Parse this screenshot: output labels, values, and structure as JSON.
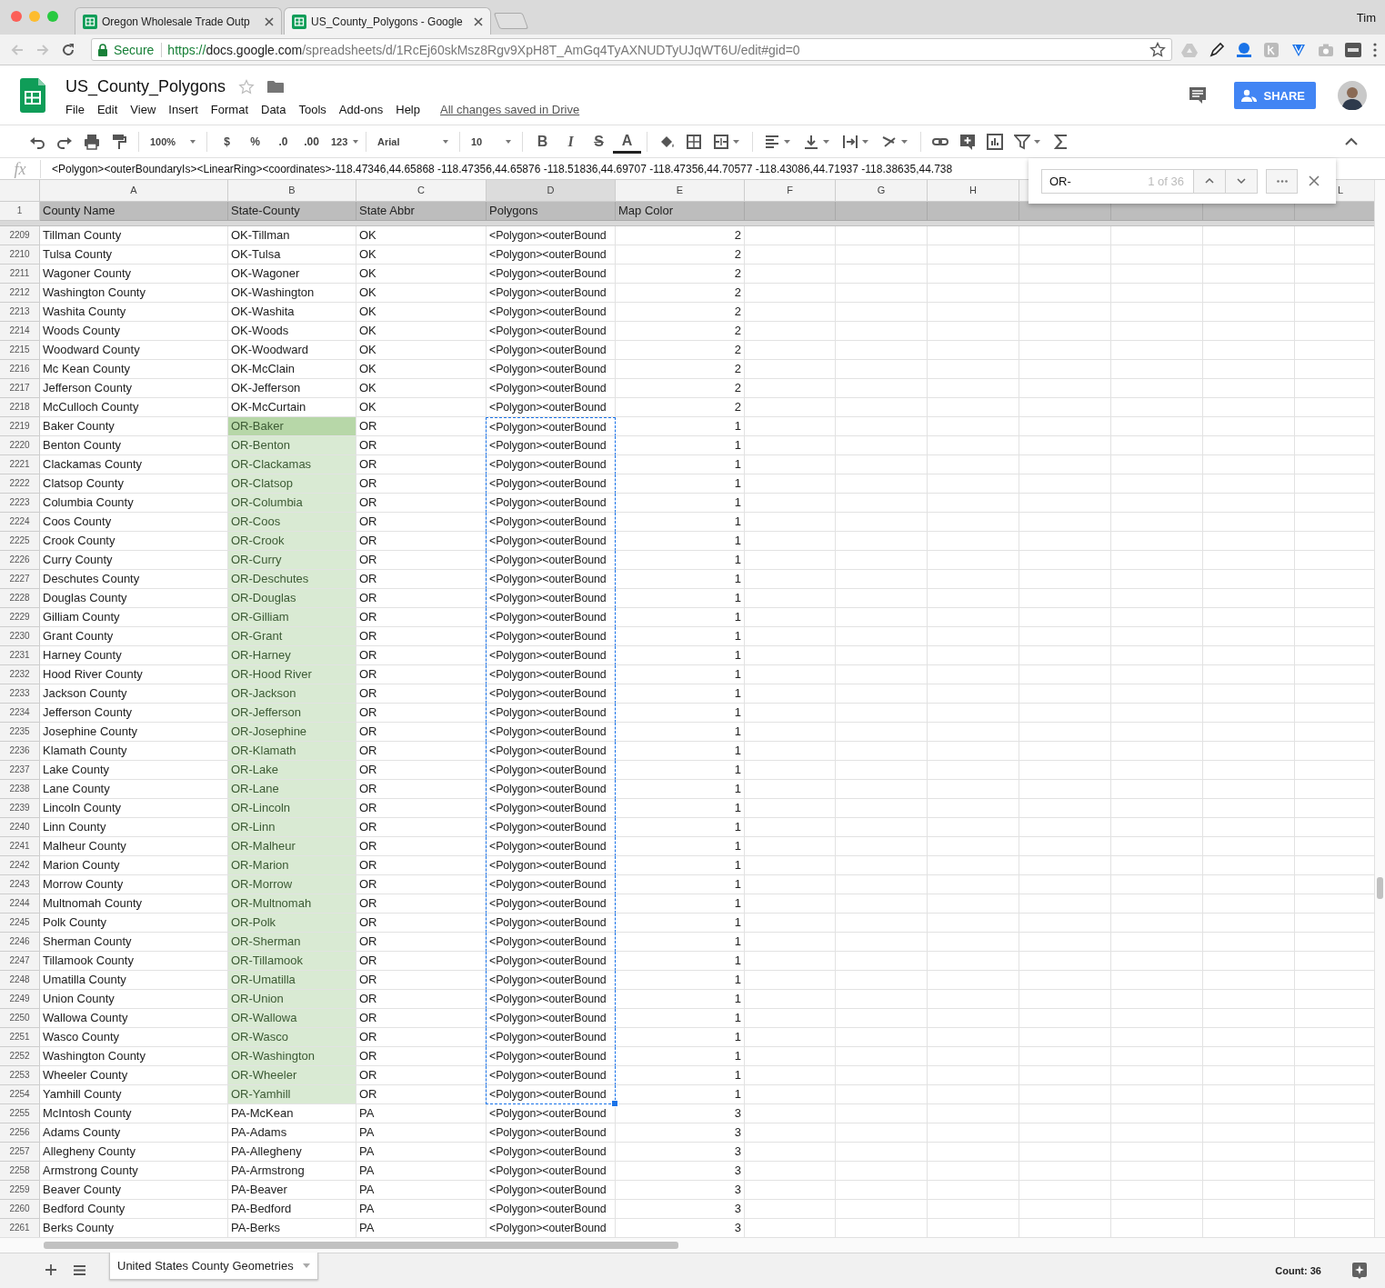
{
  "browser": {
    "tabs": [
      {
        "title": "Oregon Wholesale Trade Outp",
        "selected": false
      },
      {
        "title": "US_County_Polygons - Google",
        "selected": true
      }
    ],
    "profile": "Tim",
    "secure_label": "Secure",
    "url": "https://docs.google.com/spreadsheets/d/1RcEj60skMsz8Rgv9XpH8T_AmGq4TyAXNUDTyUJqWT6U/edit#gid=0"
  },
  "document": {
    "title": "US_County_Polygons",
    "menu": [
      "File",
      "Edit",
      "View",
      "Insert",
      "Format",
      "Data",
      "Tools",
      "Add-ons",
      "Help"
    ],
    "save_status": "All changes saved in Drive",
    "share_button": "SHARE"
  },
  "toolbar": {
    "zoom": "100%",
    "currency": "$",
    "percent": "%",
    "decrease_decimals": ".0",
    "increase_decimals": ".00",
    "number_format": "123",
    "font": "Arial",
    "font_size": "10",
    "bold": "B",
    "italic": "I",
    "strikethrough": "S",
    "text_color": "A"
  },
  "formula_bar": {
    "label": "fx",
    "content": "<Polygon><outerBoundaryIs><LinearRing><coordinates>-118.47346,44.65868 -118.47356,44.65876 -118.51836,44.69707 -118.47356,44.70577 -118.43086,44.71937 -118.38635,44.738"
  },
  "find": {
    "query": "OR-",
    "result": "1 of 36"
  },
  "grid": {
    "column_headers": [
      {
        "letter": "A",
        "selected": false
      },
      {
        "letter": "B",
        "selected": false
      },
      {
        "letter": "C",
        "selected": false
      },
      {
        "letter": "D",
        "selected": true
      },
      {
        "letter": "E",
        "selected": false
      },
      {
        "letter": "F",
        "selected": false
      },
      {
        "letter": "G",
        "selected": false
      },
      {
        "letter": "H",
        "selected": false
      },
      {
        "letter": "L",
        "selected": false
      }
    ],
    "header_row": {
      "number": "1",
      "cells": [
        "County Name",
        "State-County",
        "State Abbr",
        "Polygons",
        "Map Color"
      ]
    },
    "rows": [
      {
        "number": "2209",
        "county": "Tillman County",
        "state_county": "OK-Tillman",
        "abbr": "OK",
        "polygon": "<Polygon><outerBound",
        "map_color": "2",
        "match": false,
        "current": false,
        "copied": false
      },
      {
        "number": "2210",
        "county": "Tulsa County",
        "state_county": "OK-Tulsa",
        "abbr": "OK",
        "polygon": "<Polygon><outerBound",
        "map_color": "2",
        "match": false,
        "current": false,
        "copied": false
      },
      {
        "number": "2211",
        "county": "Wagoner County",
        "state_county": "OK-Wagoner",
        "abbr": "OK",
        "polygon": "<Polygon><outerBound",
        "map_color": "2",
        "match": false,
        "current": false,
        "copied": false
      },
      {
        "number": "2212",
        "county": "Washington County",
        "state_county": "OK-Washington",
        "abbr": "OK",
        "polygon": "<Polygon><outerBound",
        "map_color": "2",
        "match": false,
        "current": false,
        "copied": false
      },
      {
        "number": "2213",
        "county": "Washita County",
        "state_county": "OK-Washita",
        "abbr": "OK",
        "polygon": "<Polygon><outerBound",
        "map_color": "2",
        "match": false,
        "current": false,
        "copied": false
      },
      {
        "number": "2214",
        "county": "Woods County",
        "state_county": "OK-Woods",
        "abbr": "OK",
        "polygon": "<Polygon><outerBound",
        "map_color": "2",
        "match": false,
        "current": false,
        "copied": false
      },
      {
        "number": "2215",
        "county": "Woodward County",
        "state_county": "OK-Woodward",
        "abbr": "OK",
        "polygon": "<Polygon><outerBound",
        "map_color": "2",
        "match": false,
        "current": false,
        "copied": false
      },
      {
        "number": "2216",
        "county": "Mc Kean County",
        "state_county": "OK-McClain",
        "abbr": "OK",
        "polygon": "<Polygon><outerBound",
        "map_color": "2",
        "match": false,
        "current": false,
        "copied": false
      },
      {
        "number": "2217",
        "county": "Jefferson County",
        "state_county": "OK-Jefferson",
        "abbr": "OK",
        "polygon": "<Polygon><outerBound",
        "map_color": "2",
        "match": false,
        "current": false,
        "copied": false
      },
      {
        "number": "2218",
        "county": "McCulloch County",
        "state_county": "OK-McCurtain",
        "abbr": "OK",
        "polygon": "<Polygon><outerBound",
        "map_color": "2",
        "match": false,
        "current": false,
        "copied": false
      },
      {
        "number": "2219",
        "county": "Baker County",
        "state_county": "OR-Baker",
        "abbr": "OR",
        "polygon": "<Polygon><outerBound",
        "map_color": "1",
        "match": true,
        "current": true,
        "copied": true
      },
      {
        "number": "2220",
        "county": "Benton County",
        "state_county": "OR-Benton",
        "abbr": "OR",
        "polygon": "<Polygon><outerBound",
        "map_color": "1",
        "match": true,
        "current": false,
        "copied": true
      },
      {
        "number": "2221",
        "county": "Clackamas County",
        "state_county": "OR-Clackamas",
        "abbr": "OR",
        "polygon": "<Polygon><outerBound",
        "map_color": "1",
        "match": true,
        "current": false,
        "copied": true
      },
      {
        "number": "2222",
        "county": "Clatsop County",
        "state_county": "OR-Clatsop",
        "abbr": "OR",
        "polygon": "<Polygon><outerBound",
        "map_color": "1",
        "match": true,
        "current": false,
        "copied": true
      },
      {
        "number": "2223",
        "county": "Columbia County",
        "state_county": "OR-Columbia",
        "abbr": "OR",
        "polygon": "<Polygon><outerBound",
        "map_color": "1",
        "match": true,
        "current": false,
        "copied": true
      },
      {
        "number": "2224",
        "county": "Coos County",
        "state_county": "OR-Coos",
        "abbr": "OR",
        "polygon": "<Polygon><outerBound",
        "map_color": "1",
        "match": true,
        "current": false,
        "copied": true
      },
      {
        "number": "2225",
        "county": "Crook County",
        "state_county": "OR-Crook",
        "abbr": "OR",
        "polygon": "<Polygon><outerBound",
        "map_color": "1",
        "match": true,
        "current": false,
        "copied": true
      },
      {
        "number": "2226",
        "county": "Curry County",
        "state_county": "OR-Curry",
        "abbr": "OR",
        "polygon": "<Polygon><outerBound",
        "map_color": "1",
        "match": true,
        "current": false,
        "copied": true
      },
      {
        "number": "2227",
        "county": "Deschutes County",
        "state_county": "OR-Deschutes",
        "abbr": "OR",
        "polygon": "<Polygon><outerBound",
        "map_color": "1",
        "match": true,
        "current": false,
        "copied": true
      },
      {
        "number": "2228",
        "county": "Douglas County",
        "state_county": "OR-Douglas",
        "abbr": "OR",
        "polygon": "<Polygon><outerBound",
        "map_color": "1",
        "match": true,
        "current": false,
        "copied": true
      },
      {
        "number": "2229",
        "county": "Gilliam County",
        "state_county": "OR-Gilliam",
        "abbr": "OR",
        "polygon": "<Polygon><outerBound",
        "map_color": "1",
        "match": true,
        "current": false,
        "copied": true
      },
      {
        "number": "2230",
        "county": "Grant County",
        "state_county": "OR-Grant",
        "abbr": "OR",
        "polygon": "<Polygon><outerBound",
        "map_color": "1",
        "match": true,
        "current": false,
        "copied": true
      },
      {
        "number": "2231",
        "county": "Harney County",
        "state_county": "OR-Harney",
        "abbr": "OR",
        "polygon": "<Polygon><outerBound",
        "map_color": "1",
        "match": true,
        "current": false,
        "copied": true
      },
      {
        "number": "2232",
        "county": "Hood River County",
        "state_county": "OR-Hood River",
        "abbr": "OR",
        "polygon": "<Polygon><outerBound",
        "map_color": "1",
        "match": true,
        "current": false,
        "copied": true
      },
      {
        "number": "2233",
        "county": "Jackson County",
        "state_county": "OR-Jackson",
        "abbr": "OR",
        "polygon": "<Polygon><outerBound",
        "map_color": "1",
        "match": true,
        "current": false,
        "copied": true
      },
      {
        "number": "2234",
        "county": "Jefferson County",
        "state_county": "OR-Jefferson",
        "abbr": "OR",
        "polygon": "<Polygon><outerBound",
        "map_color": "1",
        "match": true,
        "current": false,
        "copied": true
      },
      {
        "number": "2235",
        "county": "Josephine County",
        "state_county": "OR-Josephine",
        "abbr": "OR",
        "polygon": "<Polygon><outerBound",
        "map_color": "1",
        "match": true,
        "current": false,
        "copied": true
      },
      {
        "number": "2236",
        "county": "Klamath County",
        "state_county": "OR-Klamath",
        "abbr": "OR",
        "polygon": "<Polygon><outerBound",
        "map_color": "1",
        "match": true,
        "current": false,
        "copied": true
      },
      {
        "number": "2237",
        "county": "Lake County",
        "state_county": "OR-Lake",
        "abbr": "OR",
        "polygon": "<Polygon><outerBound",
        "map_color": "1",
        "match": true,
        "current": false,
        "copied": true
      },
      {
        "number": "2238",
        "county": "Lane County",
        "state_county": "OR-Lane",
        "abbr": "OR",
        "polygon": "<Polygon><outerBound",
        "map_color": "1",
        "match": true,
        "current": false,
        "copied": true
      },
      {
        "number": "2239",
        "county": "Lincoln County",
        "state_county": "OR-Lincoln",
        "abbr": "OR",
        "polygon": "<Polygon><outerBound",
        "map_color": "1",
        "match": true,
        "current": false,
        "copied": true
      },
      {
        "number": "2240",
        "county": "Linn County",
        "state_county": "OR-Linn",
        "abbr": "OR",
        "polygon": "<Polygon><outerBound",
        "map_color": "1",
        "match": true,
        "current": false,
        "copied": true
      },
      {
        "number": "2241",
        "county": "Malheur County",
        "state_county": "OR-Malheur",
        "abbr": "OR",
        "polygon": "<Polygon><outerBound",
        "map_color": "1",
        "match": true,
        "current": false,
        "copied": true
      },
      {
        "number": "2242",
        "county": "Marion County",
        "state_county": "OR-Marion",
        "abbr": "OR",
        "polygon": "<Polygon><outerBound",
        "map_color": "1",
        "match": true,
        "current": false,
        "copied": true
      },
      {
        "number": "2243",
        "county": "Morrow County",
        "state_county": "OR-Morrow",
        "abbr": "OR",
        "polygon": "<Polygon><outerBound",
        "map_color": "1",
        "match": true,
        "current": false,
        "copied": true
      },
      {
        "number": "2244",
        "county": "Multnomah County",
        "state_county": "OR-Multnomah",
        "abbr": "OR",
        "polygon": "<Polygon><outerBound",
        "map_color": "1",
        "match": true,
        "current": false,
        "copied": true
      },
      {
        "number": "2245",
        "county": "Polk County",
        "state_county": "OR-Polk",
        "abbr": "OR",
        "polygon": "<Polygon><outerBound",
        "map_color": "1",
        "match": true,
        "current": false,
        "copied": true
      },
      {
        "number": "2246",
        "county": "Sherman County",
        "state_county": "OR-Sherman",
        "abbr": "OR",
        "polygon": "<Polygon><outerBound",
        "map_color": "1",
        "match": true,
        "current": false,
        "copied": true
      },
      {
        "number": "2247",
        "county": "Tillamook County",
        "state_county": "OR-Tillamook",
        "abbr": "OR",
        "polygon": "<Polygon><outerBound",
        "map_color": "1",
        "match": true,
        "current": false,
        "copied": true
      },
      {
        "number": "2248",
        "county": "Umatilla County",
        "state_county": "OR-Umatilla",
        "abbr": "OR",
        "polygon": "<Polygon><outerBound",
        "map_color": "1",
        "match": true,
        "current": false,
        "copied": true
      },
      {
        "number": "2249",
        "county": "Union County",
        "state_county": "OR-Union",
        "abbr": "OR",
        "polygon": "<Polygon><outerBound",
        "map_color": "1",
        "match": true,
        "current": false,
        "copied": true
      },
      {
        "number": "2250",
        "county": "Wallowa County",
        "state_county": "OR-Wallowa",
        "abbr": "OR",
        "polygon": "<Polygon><outerBound",
        "map_color": "1",
        "match": true,
        "current": false,
        "copied": true
      },
      {
        "number": "2251",
        "county": "Wasco County",
        "state_county": "OR-Wasco",
        "abbr": "OR",
        "polygon": "<Polygon><outerBound",
        "map_color": "1",
        "match": true,
        "current": false,
        "copied": true
      },
      {
        "number": "2252",
        "county": "Washington County",
        "state_county": "OR-Washington",
        "abbr": "OR",
        "polygon": "<Polygon><outerBound",
        "map_color": "1",
        "match": true,
        "current": false,
        "copied": true
      },
      {
        "number": "2253",
        "county": "Wheeler County",
        "state_county": "OR-Wheeler",
        "abbr": "OR",
        "polygon": "<Polygon><outerBound",
        "map_color": "1",
        "match": true,
        "current": false,
        "copied": true
      },
      {
        "number": "2254",
        "county": "Yamhill County",
        "state_county": "OR-Yamhill",
        "abbr": "OR",
        "polygon": "<Polygon><outerBound",
        "map_color": "1",
        "match": true,
        "current": false,
        "copied": true
      },
      {
        "number": "2255",
        "county": "McIntosh County",
        "state_county": "PA-McKean",
        "abbr": "PA",
        "polygon": "<Polygon><outerBound",
        "map_color": "3",
        "match": false,
        "current": false,
        "copied": false
      },
      {
        "number": "2256",
        "county": "Adams County",
        "state_county": "PA-Adams",
        "abbr": "PA",
        "polygon": "<Polygon><outerBound",
        "map_color": "3",
        "match": false,
        "current": false,
        "copied": false
      },
      {
        "number": "2257",
        "county": "Allegheny County",
        "state_county": "PA-Allegheny",
        "abbr": "PA",
        "polygon": "<Polygon><outerBound",
        "map_color": "3",
        "match": false,
        "current": false,
        "copied": false
      },
      {
        "number": "2258",
        "county": "Armstrong County",
        "state_county": "PA-Armstrong",
        "abbr": "PA",
        "polygon": "<Polygon><outerBound",
        "map_color": "3",
        "match": false,
        "current": false,
        "copied": false
      },
      {
        "number": "2259",
        "county": "Beaver County",
        "state_county": "PA-Beaver",
        "abbr": "PA",
        "polygon": "<Polygon><outerBound",
        "map_color": "3",
        "match": false,
        "current": false,
        "copied": false
      },
      {
        "number": "2260",
        "county": "Bedford County",
        "state_county": "PA-Bedford",
        "abbr": "PA",
        "polygon": "<Polygon><outerBound",
        "map_color": "3",
        "match": false,
        "current": false,
        "copied": false
      },
      {
        "number": "2261",
        "county": "Berks County",
        "state_county": "PA-Berks",
        "abbr": "PA",
        "polygon": "<Polygon><outerBound",
        "map_color": "3",
        "match": false,
        "current": false,
        "copied": false
      }
    ]
  },
  "footer": {
    "sheet_tab": "United States County Geometries",
    "status": "Count: 36"
  }
}
